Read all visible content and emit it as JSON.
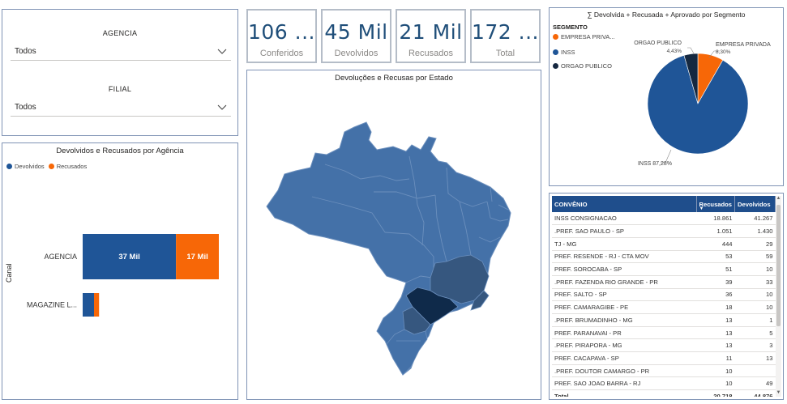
{
  "slicers": {
    "agencia": {
      "label": "AGENCIA",
      "value": "Todos"
    },
    "filial": {
      "label": "FILIAL",
      "value": "Todos"
    }
  },
  "cards": [
    {
      "value": "106 ...",
      "label": "Conferidos"
    },
    {
      "value": "45 Mil",
      "label": "Devolvidos"
    },
    {
      "value": "21 Mil",
      "label": "Recusados"
    },
    {
      "value": "172 ...",
      "label": "Total"
    }
  ],
  "bar_chart": {
    "title": "Devolvidos e Recusados por Agência",
    "legend": [
      {
        "name": "Devolvidos",
        "color": "#1f5597"
      },
      {
        "name": "Recusados",
        "color": "#f76707"
      }
    ],
    "ylabel": "Canal",
    "colors": {
      "devolvidos": "#1f5597",
      "recusados": "#f76707"
    }
  },
  "map": {
    "title": "Devoluções e Recusas por Estado",
    "colors": {
      "base": "#4471a8",
      "mid": "#36577f",
      "dark": "#0f2a4a"
    }
  },
  "pie": {
    "title": "∑ Devolvida + Recusada + Aprovado por Segmento",
    "legend_title": "SEGMENTO",
    "legend": [
      {
        "name": "EMPRESA PRIVA...",
        "color": "#f76707"
      },
      {
        "name": "INSS",
        "color": "#1f5597"
      },
      {
        "name": "ORGAO PUBLICO",
        "color": "#152840"
      }
    ],
    "labels": {
      "empresa_name": "EMPRESA PRIVADA",
      "empresa_pct": "8,30%",
      "orgao_name": "ORGAO PUBLICO",
      "orgao_pct": "4,43%",
      "inss": "INSS 87,28%"
    }
  },
  "table": {
    "headers": {
      "convenio": "CONVÊNIO",
      "recusados": "Recusados",
      "devolvidos": "Devolvidos"
    },
    "rows": [
      {
        "convenio": "INSS CONSIGNACAO",
        "recusados": "18.861",
        "devolvidos": "41.267"
      },
      {
        "convenio": ".PREF. SAO PAULO - SP",
        "recusados": "1.051",
        "devolvidos": "1.430"
      },
      {
        "convenio": "TJ - MG",
        "recusados": "444",
        "devolvidos": "29"
      },
      {
        "convenio": "PREF. RESENDE - RJ - CTA MOV",
        "recusados": "53",
        "devolvidos": "59"
      },
      {
        "convenio": "PREF. SOROCABA - SP",
        "recusados": "51",
        "devolvidos": "10"
      },
      {
        "convenio": ".PREF. FAZENDA RIO GRANDE - PR",
        "recusados": "39",
        "devolvidos": "33"
      },
      {
        "convenio": "PREF. SALTO - SP",
        "recusados": "36",
        "devolvidos": "10"
      },
      {
        "convenio": "PREF. CAMARAGIBE - PE",
        "recusados": "18",
        "devolvidos": "10"
      },
      {
        "convenio": ".PREF. BRUMADINHO - MG",
        "recusados": "13",
        "devolvidos": "1"
      },
      {
        "convenio": "PREF. PARANAVAI - PR",
        "recusados": "13",
        "devolvidos": "5"
      },
      {
        "convenio": ".PREF. PIRAPORA - MG",
        "recusados": "13",
        "devolvidos": "3"
      },
      {
        "convenio": "PREF. CACAPAVA - SP",
        "recusados": "11",
        "devolvidos": "13"
      },
      {
        "convenio": ".PREF. DOUTOR CAMARGO - PR",
        "recusados": "10",
        "devolvidos": ""
      },
      {
        "convenio": "PREF. SAO JOAO BARRA - RJ",
        "recusados": "10",
        "devolvidos": "49"
      }
    ],
    "total": {
      "label": "Total",
      "recusados": "20.718",
      "devolvidos": "44.876"
    }
  },
  "chart_data": [
    {
      "type": "bar",
      "title": "Devolvidos e Recusados por Agência",
      "ylabel": "Canal",
      "categories": [
        "AGENCIA",
        "MAGAZINE L..."
      ],
      "series": [
        {
          "name": "Devolvidos",
          "values": [
            37000,
            4500
          ],
          "data_labels": [
            "37 Mil",
            ""
          ]
        },
        {
          "name": "Recusados",
          "values": [
            17000,
            2000
          ],
          "data_labels": [
            "17 Mil",
            ""
          ]
        }
      ]
    },
    {
      "type": "pie",
      "title": "∑ Devolvida + Recusada + Aprovado por Segmento",
      "categories": [
        "EMPRESA PRIVADA",
        "INSS",
        "ORGAO PUBLICO"
      ],
      "values": [
        8.3,
        87.28,
        4.43
      ]
    }
  ]
}
